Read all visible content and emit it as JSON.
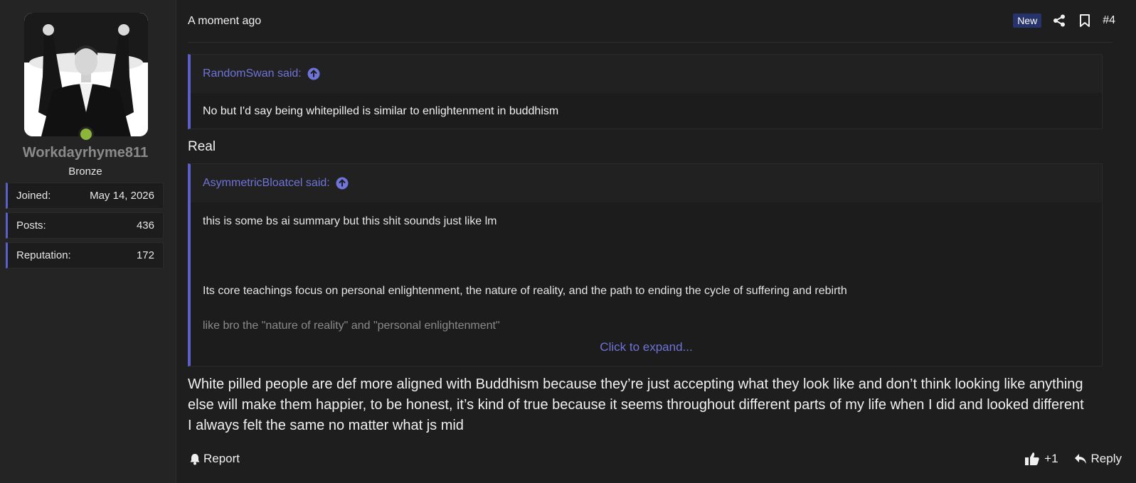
{
  "user": {
    "username": "Workdayrhyme811",
    "title": "Bronze",
    "status": "online",
    "avatar_icon": "avatar-photo",
    "stats": [
      {
        "label": "Joined:",
        "value": "May 14, 2026"
      },
      {
        "label": "Posts:",
        "value": "436"
      },
      {
        "label": "Reputation:",
        "value": "172"
      }
    ]
  },
  "meta": {
    "timestamp": "A moment ago",
    "badge": "New",
    "post_number": "#4",
    "share_icon": "share-icon",
    "bookmark_icon": "bookmark-icon"
  },
  "quotes": [
    {
      "author_line": "RandomSwan said:",
      "lines": [
        "No but I'd say being whitepilled is similar to enlightenment in buddhism"
      ]
    },
    {
      "author_line": "AsymmetricBloatcel said:",
      "lines": [
        "this is some bs ai summary but this shit sounds just like lm",
        "Its core teachings focus on personal enlightenment, the nature of reality, and the path to ending the cycle of suffering and rebirth",
        "like bro the \"nature of reality\" and \"personal enlightenment\""
      ],
      "expand_label": "Click to expand..."
    }
  ],
  "body": {
    "line_after_first_quote": "Real",
    "reply": "White pilled people are def more aligned with Buddhism because they’re just accepting what they look like and don’t think looking like anything else will make them happier, to be honest, it’s kind of true because it seems throughout different parts of my life when I did and looked different I always felt the same no matter what js mid"
  },
  "footer": {
    "report_label": "Report",
    "like_count": "+1",
    "reply_label": "Reply"
  },
  "colors": {
    "accent": "#5b5fc7",
    "link": "#6f74d8",
    "badge_bg": "#27336b",
    "online": "#8bb63a",
    "background": "#1e1e1e"
  }
}
